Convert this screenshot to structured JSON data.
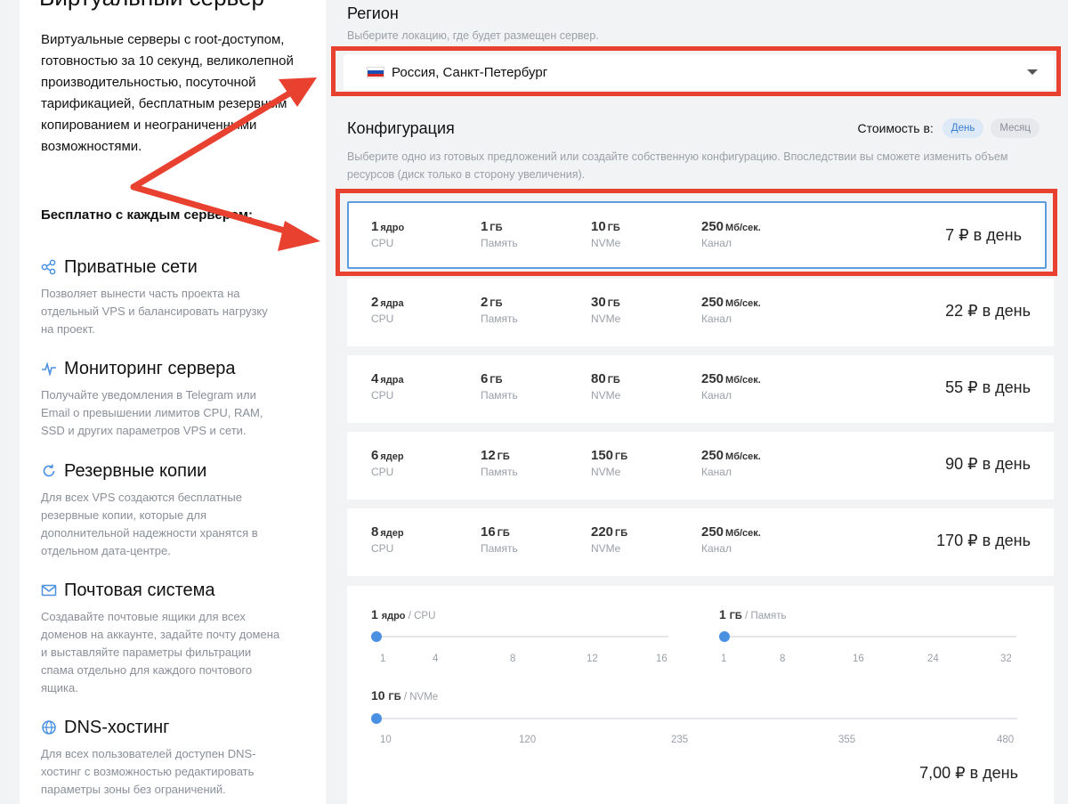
{
  "left": {
    "title": "Виртуальный сервер",
    "intro": "Виртуальные серверы с root-доступом, готовностью за 10 секунд, великолепной производительностью, посуточной тарификацией, бесплатным резервным копированием и неограниченными возможностями.",
    "free_title": "Бесплатно с каждым сервером:",
    "features": [
      {
        "icon": "network-icon",
        "title": "Приватные сети",
        "desc": "Позволяет вынести часть проекта на отдельный VPS и балансировать нагрузку на проект."
      },
      {
        "icon": "pulse-icon",
        "title": "Мониторинг сервера",
        "desc": "Получайте уведомления в Telegram или Email о превышении лимитов CPU, RAM, SSD и других параметров VPS и сети."
      },
      {
        "icon": "refresh-icon",
        "title": "Резервные копии",
        "desc": "Для всех VPS создаются бесплатные резервные копии, которые для дополнительной надежности хранятся в отдельном дата-центре."
      },
      {
        "icon": "mail-icon",
        "title": "Почтовая система",
        "desc": "Создавайте почтовые ящики для всех доменов на аккаунте, задайте почту домена и выставляйте параметры фильтрации спама отдельно для каждого почтового ящика."
      },
      {
        "icon": "globe-icon",
        "title": "DNS-хостинг",
        "desc": "Для всех пользователей доступен DNS-хостинг с возможностью редактировать параметры зоны без ограничений."
      }
    ]
  },
  "region": {
    "title": "Регион",
    "hint": "Выберите локацию, где будет размещен сервер.",
    "selected": "Россия, Санкт-Петербург",
    "flag_colors": [
      "#ffffff",
      "#1c4fb5",
      "#d6261f"
    ]
  },
  "config": {
    "title": "Конфигурация",
    "hint": "Выберите одно из готовых предложений или создайте собственную конфигурацию. Впоследствии вы сможете изменить объем ресурсов (диск только в сторону увеличения).",
    "cost_label": "Стоимость в:",
    "period_day": "День",
    "period_month": "Месяц",
    "plans": [
      {
        "cpu": "1",
        "cpu_unit": "ядро",
        "cpu_label": "CPU",
        "ram": "1",
        "ram_unit": "ГБ",
        "ram_label": "Память",
        "disk": "10",
        "disk_unit": "ГБ",
        "disk_label": "NVMe",
        "net": "250",
        "net_unit": "Мб/сек.",
        "net_label": "Канал",
        "price": "7 ₽ в день"
      },
      {
        "cpu": "2",
        "cpu_unit": "ядра",
        "cpu_label": "CPU",
        "ram": "2",
        "ram_unit": "ГБ",
        "ram_label": "Память",
        "disk": "30",
        "disk_unit": "ГБ",
        "disk_label": "NVMe",
        "net": "250",
        "net_unit": "Мб/сек.",
        "net_label": "Канал",
        "price": "22 ₽ в день"
      },
      {
        "cpu": "4",
        "cpu_unit": "ядра",
        "cpu_label": "CPU",
        "ram": "6",
        "ram_unit": "ГБ",
        "ram_label": "Память",
        "disk": "80",
        "disk_unit": "ГБ",
        "disk_label": "NVMe",
        "net": "250",
        "net_unit": "Мб/сек.",
        "net_label": "Канал",
        "price": "55 ₽ в день"
      },
      {
        "cpu": "6",
        "cpu_unit": "ядер",
        "cpu_label": "CPU",
        "ram": "12",
        "ram_unit": "ГБ",
        "ram_label": "Память",
        "disk": "150",
        "disk_unit": "ГБ",
        "disk_label": "NVMe",
        "net": "250",
        "net_unit": "Мб/сек.",
        "net_label": "Канал",
        "price": "90 ₽ в день"
      },
      {
        "cpu": "8",
        "cpu_unit": "ядер",
        "cpu_label": "CPU",
        "ram": "16",
        "ram_unit": "ГБ",
        "ram_label": "Память",
        "disk": "220",
        "disk_unit": "ГБ",
        "disk_label": "NVMe",
        "net": "250",
        "net_unit": "Мб/сек.",
        "net_label": "Канал",
        "price": "170 ₽ в день"
      }
    ],
    "custom": {
      "cpu": {
        "value": "1",
        "unit": "ядро",
        "sep": " / ",
        "label": "CPU",
        "ticks": [
          "1",
          "4",
          "8",
          "12",
          "16"
        ]
      },
      "ram": {
        "value": "1",
        "unit": "ГБ",
        "sep": " / ",
        "label": "Память",
        "ticks": [
          "1",
          "8",
          "16",
          "24",
          "32"
        ]
      },
      "disk": {
        "value": "10",
        "unit": "ГБ",
        "sep": " / ",
        "label": "NVMe",
        "ticks": [
          "10",
          "120",
          "235",
          "355",
          "480"
        ]
      },
      "total": "7,00 ₽ в день"
    }
  },
  "colors": {
    "accent": "#4a90e2",
    "annotation": "#e8412f"
  }
}
